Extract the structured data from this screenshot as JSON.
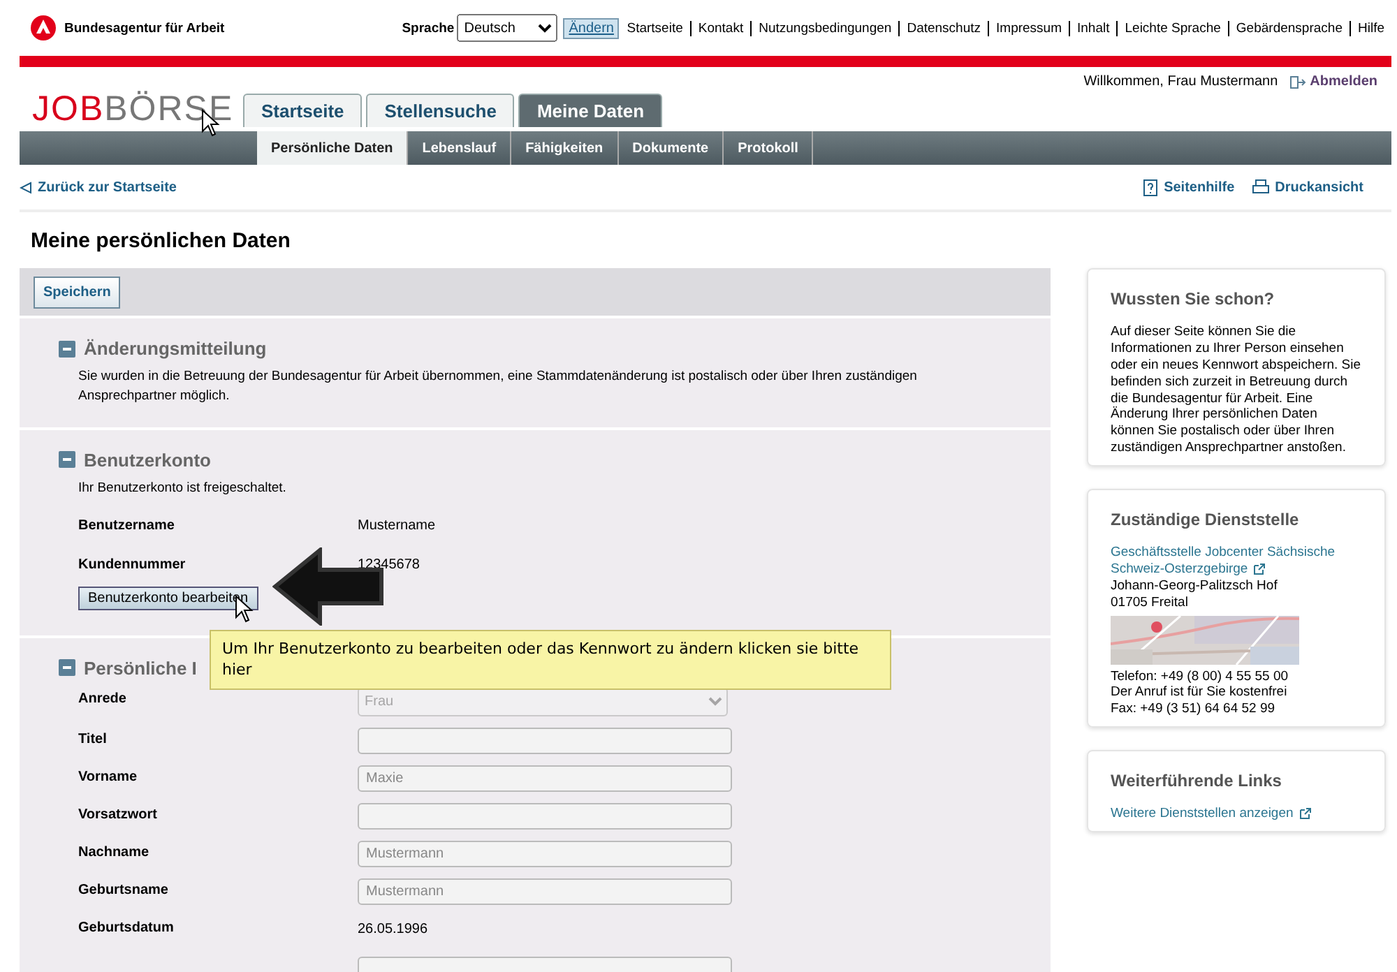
{
  "header": {
    "agency": "Bundesagentur für Arbeit",
    "language_label": "Sprache",
    "language": "Deutsch",
    "change_button": "Ändern",
    "links": [
      "Startseite",
      "Kontakt",
      "Nutzungsbedingungen",
      "Datenschutz",
      "Impressum",
      "Inhalt",
      "Leichte Sprache",
      "Gebärdensprache",
      "Hilfe"
    ]
  },
  "logo": {
    "first": "JOB",
    "second": "BÖRSE"
  },
  "user": {
    "welcome": "Willkommen, Frau Mustermann",
    "logout": "Abmelden"
  },
  "tabs": [
    {
      "label": "Startseite",
      "selected": false
    },
    {
      "label": "Stellensuche",
      "selected": false
    },
    {
      "label": "Meine Daten",
      "selected": true
    }
  ],
  "subtabs": [
    {
      "label": "Persönliche Daten",
      "selected": true
    },
    {
      "label": "Lebenslauf",
      "selected": false
    },
    {
      "label": "Fähigkeiten",
      "selected": false
    },
    {
      "label": "Dokumente",
      "selected": false
    },
    {
      "label": "Protokoll",
      "selected": false
    }
  ],
  "toolbar": {
    "back": "Zurück zur Startseite",
    "help": "Seitenhilfe",
    "print": "Druckansicht"
  },
  "page_title": "Meine persönlichen Daten",
  "save_button": "Speichern",
  "notice": {
    "title": "Änderungsmitteilung",
    "expanded": true,
    "text": "Sie wurden in die Betreuung der Bundesagentur für Arbeit übernommen, eine Stammdatenänderung ist postalisch oder über Ihren zuständigen Ansprechpartner möglich."
  },
  "account": {
    "title": "Benutzerkonto",
    "expanded": true,
    "status": "Ihr Benutzerkonto ist freigeschaltet.",
    "rows": [
      {
        "label": "Benutzername",
        "value": "Mustername"
      },
      {
        "label": "Kundennummer",
        "value": "12345678"
      }
    ],
    "edit_button": "Benutzerkonto bearbeiten"
  },
  "tooltip": "Um Ihr Benutzerkonto zu bearbeiten oder das Kennwort zu ändern klicken sie bitte hier",
  "personal": {
    "title": "Persönliche I",
    "expanded": true,
    "fields": [
      {
        "kind": "select",
        "label": "Anrede",
        "value": "Frau",
        "disabled": true
      },
      {
        "kind": "input",
        "label": "Titel",
        "disabled": true
      },
      {
        "kind": "input",
        "label": "Vorname",
        "value": "Maxie",
        "disabled": true
      },
      {
        "kind": "input",
        "label": "Vorsatzwort",
        "disabled": true
      },
      {
        "kind": "input",
        "label": "Nachname",
        "value": "Mustermann",
        "disabled": true
      },
      {
        "kind": "input",
        "label": "Geburtsname",
        "value": "Mustermann",
        "disabled": true
      },
      {
        "kind": "text",
        "label": "Geburtsdatum",
        "value": "26.05.1996"
      },
      {
        "kind": "input",
        "disabled": true
      }
    ]
  },
  "sidebar": [
    {
      "kind": "info",
      "title": "Wussten Sie schon?",
      "text": "Auf dieser Seite können Sie die Informationen zu Ihrer Person einsehen oder ein neues Kennwort abspeichern. Sie befinden sich zurzeit in Betreuung durch die Bundesagentur für Arbeit. Eine Änderung Ihrer persönlichen Daten können Sie postalisch oder über Ihren zuständigen Ansprechpartner anstoßen."
    },
    {
      "kind": "office",
      "title": "Zuständige Dienststelle",
      "link": "Geschäftsstelle Jobcenter Sächsische Schweiz-Osterzgebirge",
      "address": [
        "Johann-Georg-Palitzsch Hof",
        "01705 Freital"
      ],
      "contact": [
        "Telefon: +49 (8 00) 4 55 55 00",
        "Der Anruf ist für Sie kostenfrei",
        "Fax: +49 (3 51) 64 64 52 99"
      ]
    },
    {
      "kind": "links",
      "title": "Weiterführende Links",
      "link": "Weitere Dienststellen anzeigen"
    }
  ]
}
